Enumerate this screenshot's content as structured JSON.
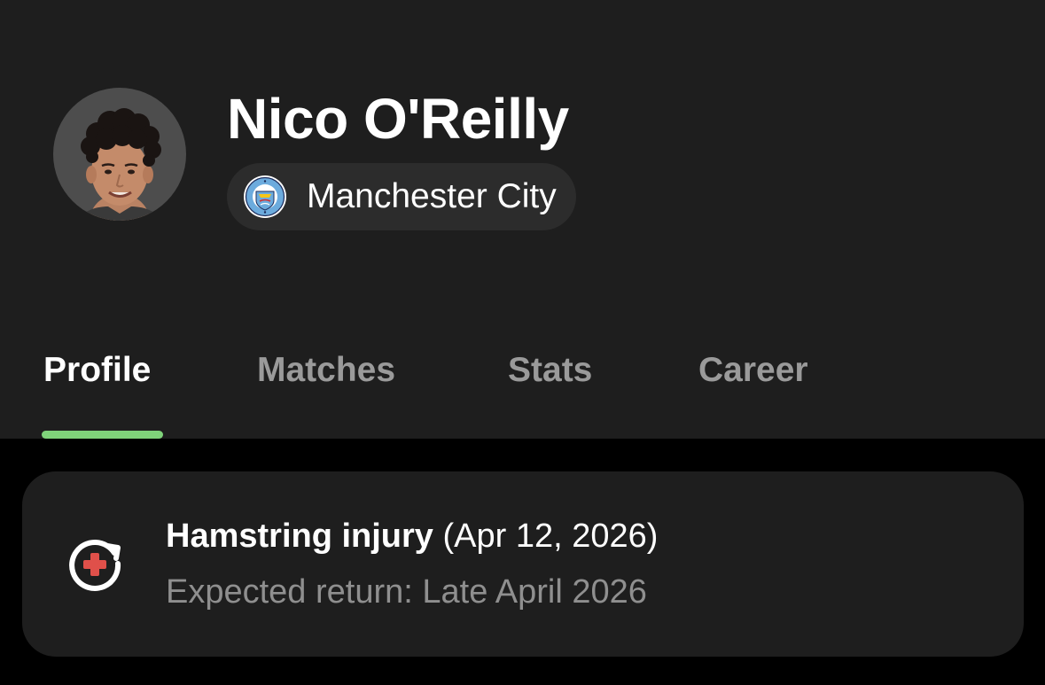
{
  "player": {
    "name": "Nico O'Reilly",
    "avatar_icon": "player-photo",
    "team": {
      "name": "Manchester City",
      "crest_icon": "manchester-city-crest",
      "crest_color": "#6CABDD"
    }
  },
  "tabs": [
    {
      "label": "Profile",
      "active": true
    },
    {
      "label": "Matches",
      "active": false
    },
    {
      "label": "Stats",
      "active": false
    },
    {
      "label": "Career",
      "active": false
    }
  ],
  "injury": {
    "icon": "injury-return-icon",
    "type": "Hamstring injury",
    "date": "(Apr 12, 2026)",
    "expected_return": "Expected return: Late April 2026"
  },
  "colors": {
    "header_bg": "#1e1e1e",
    "page_bg": "#000000",
    "active_tab_indicator": "#7fd37a",
    "inactive_tab_text": "#9a9a9a",
    "injury_cross": "#e0504a"
  }
}
